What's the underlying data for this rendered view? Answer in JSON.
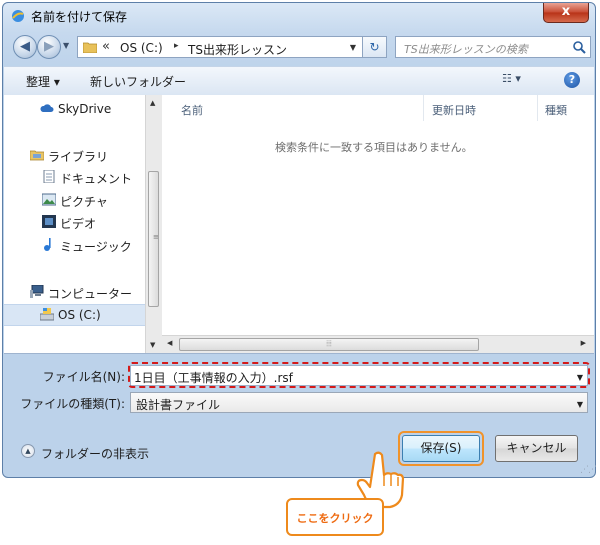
{
  "window": {
    "title": "名前を付けて保存",
    "close_label": "x"
  },
  "address": {
    "chevron": "«",
    "segments": [
      "OS (C:)",
      "TS出来形レッスン"
    ],
    "separator": "▸"
  },
  "search": {
    "placeholder": "TS出来形レッスンの検索"
  },
  "toolbar": {
    "organize": "整理 ▾",
    "new_folder": "新しいフォルダー",
    "view": "☷ ▾",
    "help": "?"
  },
  "nav": {
    "items": [
      {
        "label": "SkyDrive",
        "icon": "cloud-icon"
      },
      {
        "label": "ライブラリ",
        "icon": "library-icon"
      },
      {
        "label": "ドキュメント",
        "icon": "document-icon"
      },
      {
        "label": "ピクチャ",
        "icon": "picture-icon"
      },
      {
        "label": "ビデオ",
        "icon": "video-icon"
      },
      {
        "label": "ミュージック",
        "icon": "music-icon"
      },
      {
        "label": "コンピューター",
        "icon": "computer-icon"
      },
      {
        "label": "OS (C:)",
        "icon": "drive-icon"
      }
    ]
  },
  "columns": {
    "name": "名前",
    "modified": "更新日時",
    "type": "種類"
  },
  "empty_message": "検索条件に一致する項目はありません。",
  "form": {
    "filename_label": "ファイル名(N):",
    "filename_value": "1日目（工事情報の入力）.rsf",
    "filetype_label": "ファイルの種類(T):",
    "filetype_value": "設計書ファイル"
  },
  "bottom": {
    "hide_folders": "フォルダーの非表示",
    "save": "保存(S)",
    "cancel": "キャンセル"
  },
  "callout": {
    "text": "ここをクリック"
  },
  "colors": {
    "highlight_red": "#d41a1a",
    "accent_orange": "#ee8a1c"
  }
}
